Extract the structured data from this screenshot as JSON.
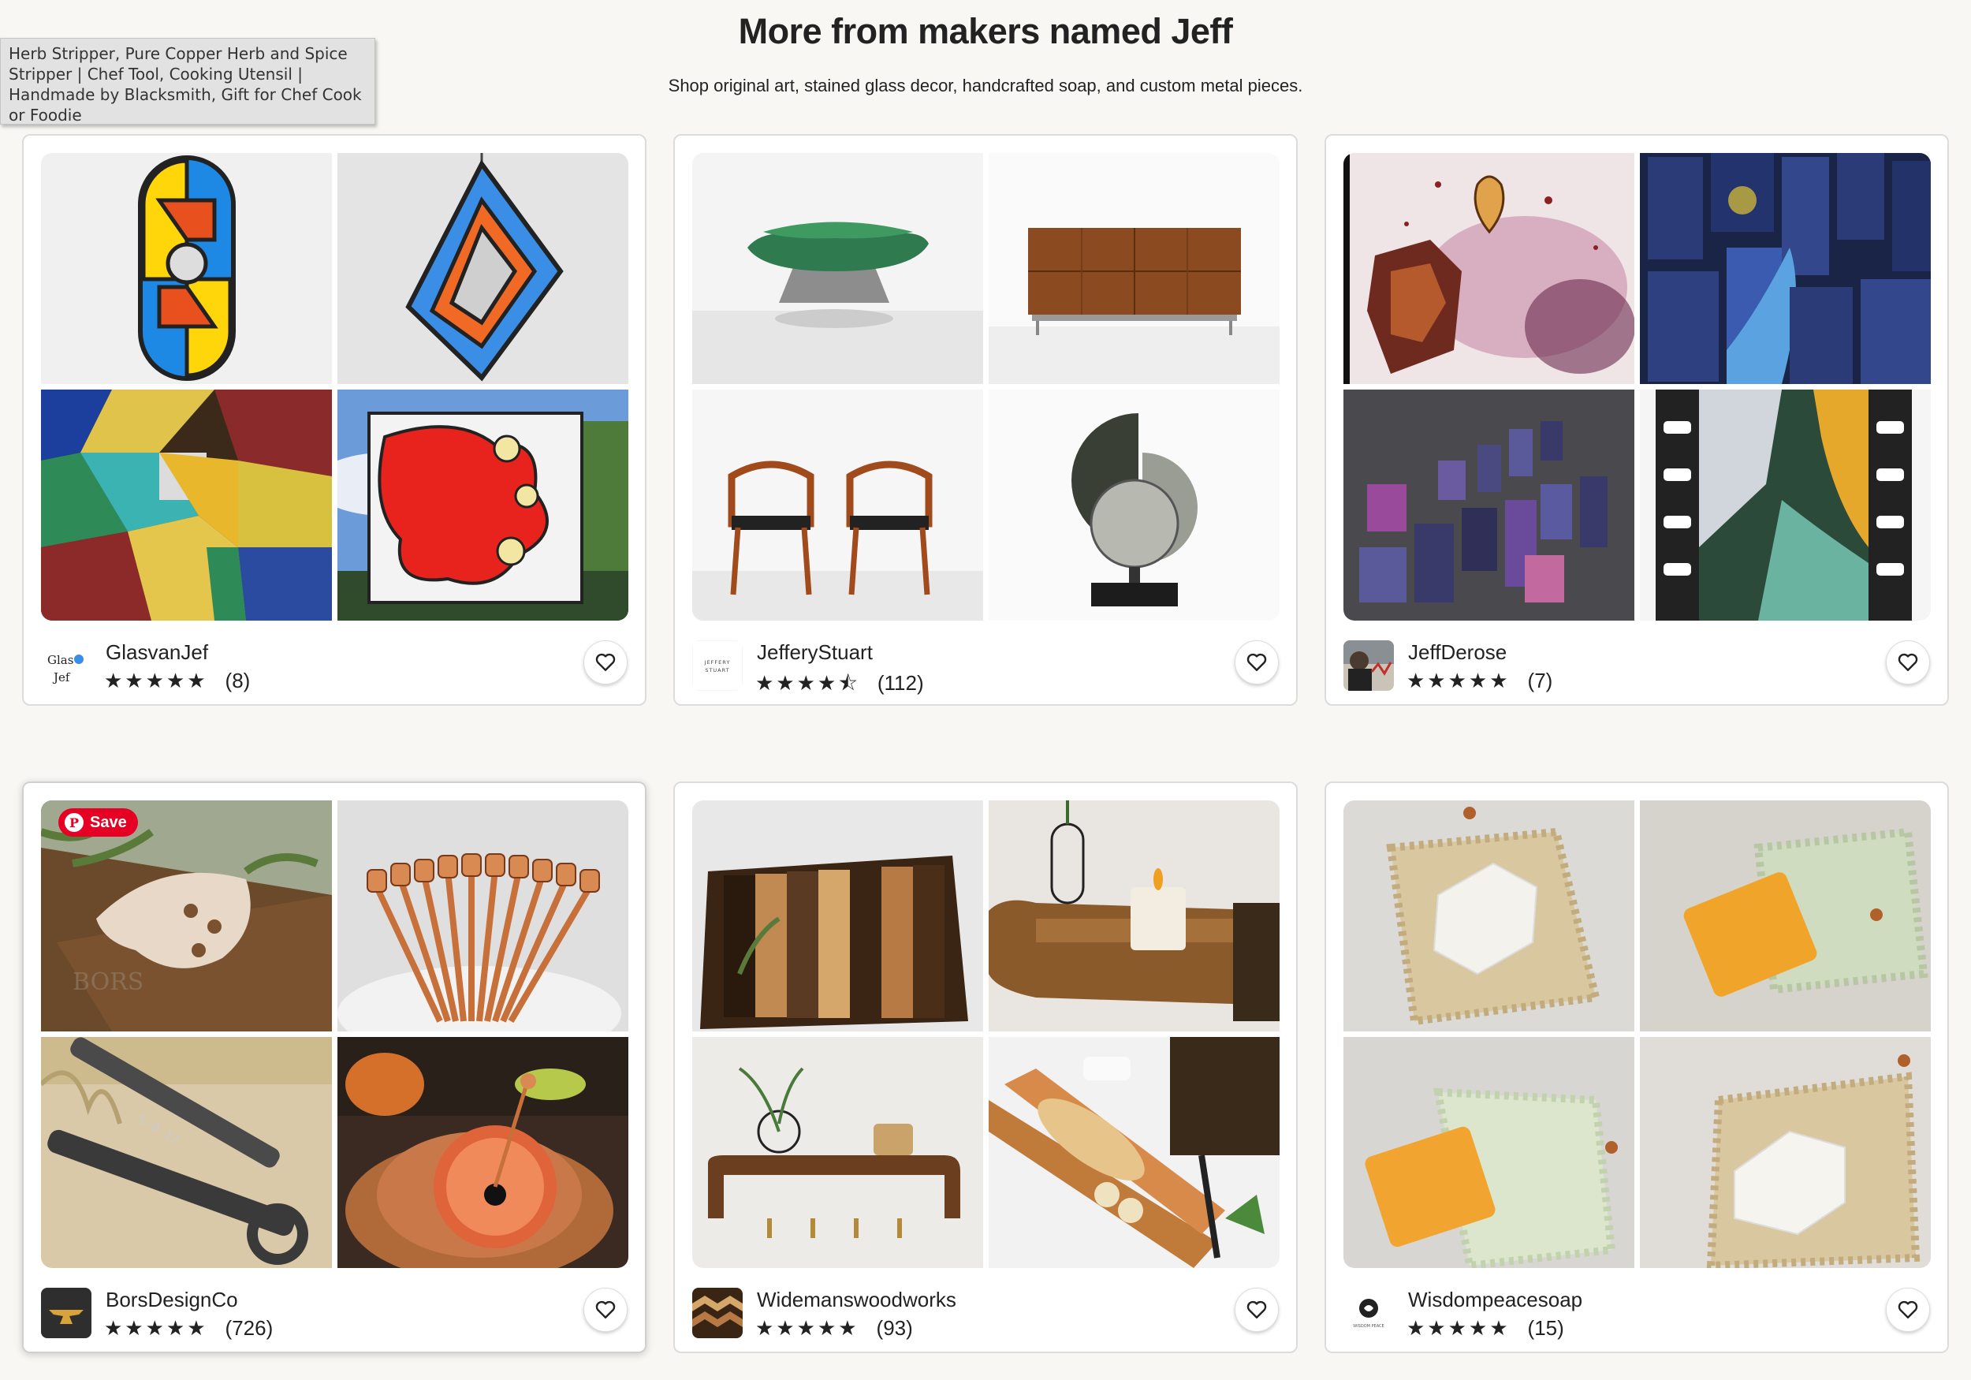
{
  "header": {
    "title": "More from makers named Jeff",
    "subtitle": "Shop original art, stained glass decor, handcrafted soap, and custom metal pieces."
  },
  "tooltip": {
    "text": "Herb Stripper, Pure Copper Herb and Spice Stripper | Chef Tool, Cooking Utensil | Handmade by Blacksmith, Gift for Chef Cook or Foodie"
  },
  "save_pill": {
    "label": "Save",
    "icon": "pinterest-icon"
  },
  "shops": [
    {
      "name": "GlasvanJef",
      "rating": 5,
      "stars": "★★★★★",
      "count": "(8)",
      "avatar_text": "Glas van Jef"
    },
    {
      "name": "JefferyStuart",
      "rating": 4.5,
      "stars": "★★★★⯪",
      "count": "(112)",
      "avatar_text": "JEFFERY STUART"
    },
    {
      "name": "JeffDerose",
      "rating": 5,
      "stars": "★★★★★",
      "count": "(7)"
    },
    {
      "name": "BorsDesignCo",
      "rating": 5,
      "stars": "★★★★★",
      "count": "(726)"
    },
    {
      "name": "Widemanswoodworks",
      "rating": 5,
      "stars": "★★★★★",
      "count": "(93)"
    },
    {
      "name": "Wisdompeacesoap",
      "rating": 5,
      "stars": "★★★★★",
      "count": "(15)"
    }
  ],
  "icons": {
    "favorite": "heart-icon",
    "star": "star-icon"
  }
}
